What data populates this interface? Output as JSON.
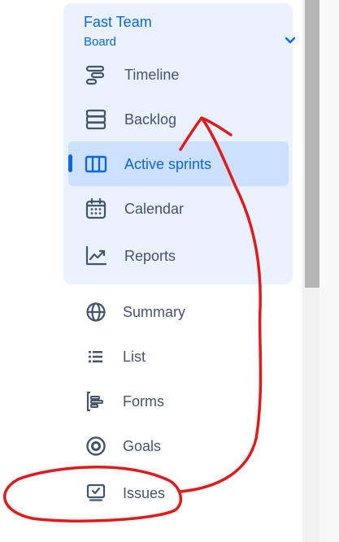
{
  "board": {
    "title": "Fast Team",
    "subtitle": "Board",
    "items": [
      {
        "label": "Timeline",
        "icon": "timeline-icon"
      },
      {
        "label": "Backlog",
        "icon": "backlog-icon"
      },
      {
        "label": "Active sprints",
        "icon": "active-sprints-icon",
        "active": true
      },
      {
        "label": "Calendar",
        "icon": "calendar-icon"
      },
      {
        "label": "Reports",
        "icon": "reports-icon"
      }
    ]
  },
  "project": {
    "items": [
      {
        "label": "Summary",
        "icon": "globe-icon"
      },
      {
        "label": "List",
        "icon": "list-icon"
      },
      {
        "label": "Forms",
        "icon": "forms-icon"
      },
      {
        "label": "Goals",
        "icon": "goals-icon"
      },
      {
        "label": "Issues",
        "icon": "issues-icon"
      }
    ]
  },
  "colors": {
    "accent": "#0c66e4",
    "group_background": "#e9f2fe",
    "active_background": "#cce0ff",
    "text": "#44546f",
    "annotation": "#e01b1b"
  }
}
